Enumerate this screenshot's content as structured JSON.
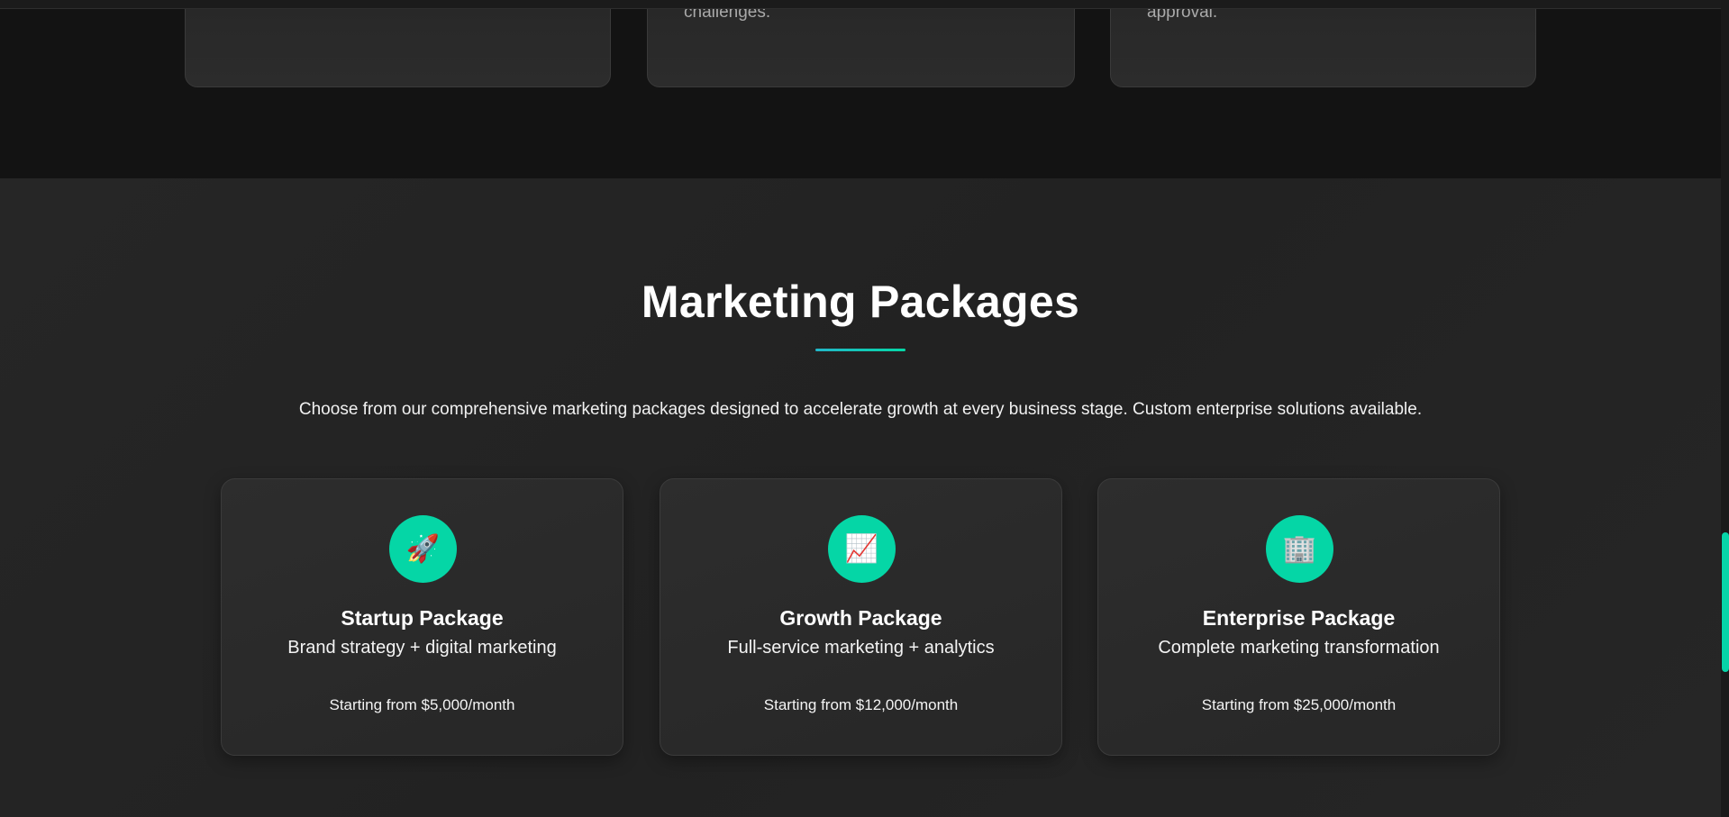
{
  "top_cards": [
    {
      "tail_text": ""
    },
    {
      "tail_text": "challenges."
    },
    {
      "tail_text": "approval."
    }
  ],
  "packages_section": {
    "title": "Marketing Packages",
    "description": "Choose from our comprehensive marketing packages designed to accelerate growth at every business stage. Custom enterprise solutions available.",
    "accent_color": "#05d6a6",
    "packages": [
      {
        "icon": "🚀",
        "icon_name": "rocket-icon",
        "name": "Startup Package",
        "subtitle": "Brand strategy + digital marketing",
        "price": "Starting from $5,000/month"
      },
      {
        "icon": "📈",
        "icon_name": "chart-increasing-icon",
        "name": "Growth Package",
        "subtitle": "Full-service marketing + analytics",
        "price": "Starting from $12,000/month"
      },
      {
        "icon": "🏢",
        "icon_name": "office-building-icon",
        "name": "Enterprise Package",
        "subtitle": "Complete marketing transformation",
        "price": "Starting from $25,000/month"
      }
    ]
  }
}
